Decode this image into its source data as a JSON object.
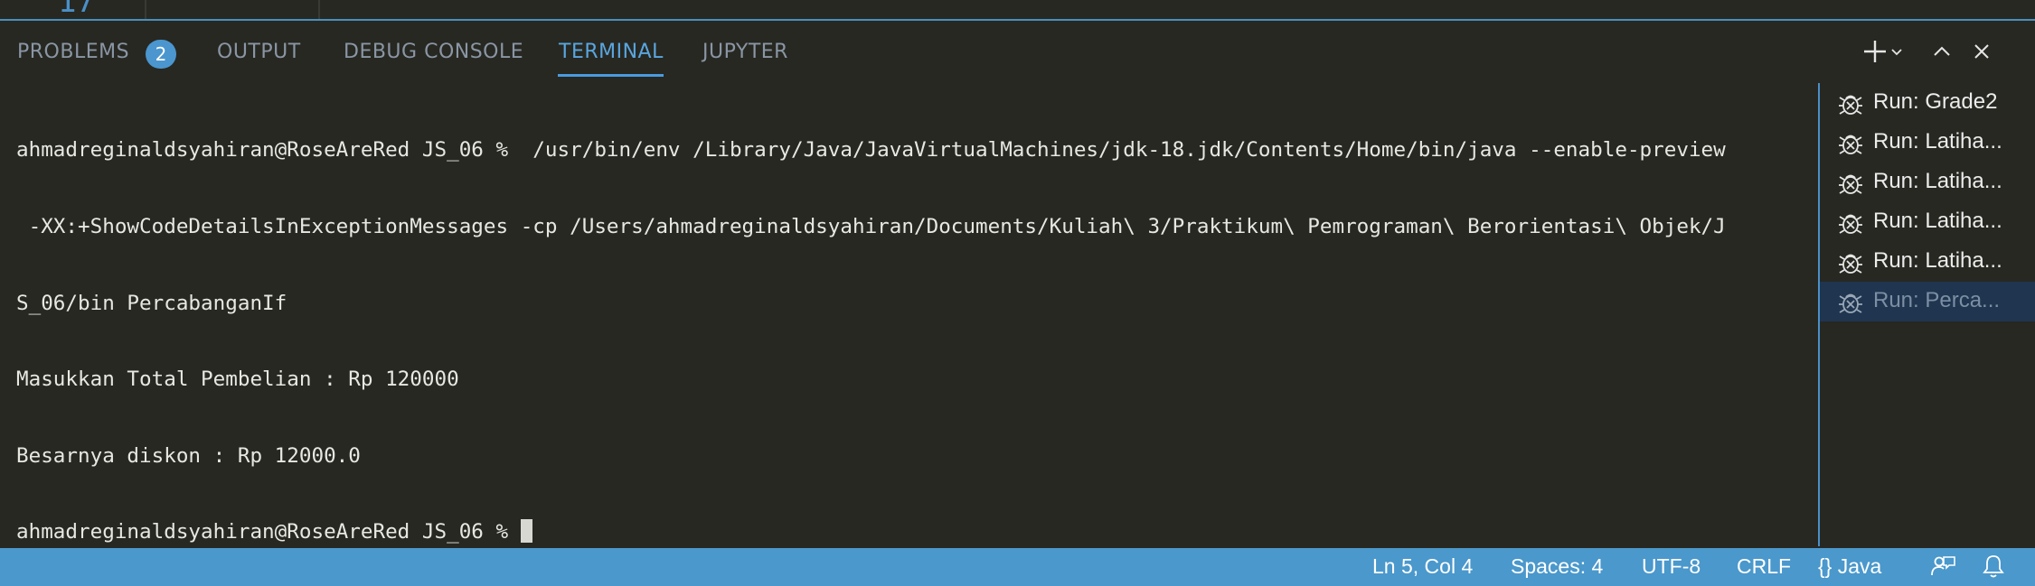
{
  "editor": {
    "visible_line_number": "17"
  },
  "panel": {
    "tabs": [
      {
        "label": "PROBLEMS",
        "badge": "2"
      },
      {
        "label": "OUTPUT"
      },
      {
        "label": "DEBUG CONSOLE"
      },
      {
        "label": "TERMINAL",
        "active": true
      },
      {
        "label": "JUPYTER"
      }
    ],
    "actions": [
      "plus-icon",
      "chevron-down-icon",
      "chevron-up-icon",
      "close-icon"
    ]
  },
  "terminal": {
    "lines": [
      "ahmadreginaldsyahiran@RoseAreRed JS_06 %  /usr/bin/env /Library/Java/JavaVirtualMachines/jdk-18.jdk/Contents/Home/bin/java --enable-preview",
      " -XX:+ShowCodeDetailsInExceptionMessages -cp /Users/ahmadreginaldsyahiran/Documents/Kuliah\\ 3/Praktikum\\ Pemrograman\\ Berorientasi\\ Objek/J",
      "S_06/bin PercabanganIf",
      "Masukkan Total Pembelian : Rp 120000",
      "Besarnya diskon : Rp 12000.0",
      "ahmadreginaldsyahiran@RoseAreRed JS_06 % "
    ]
  },
  "terminal_list": [
    {
      "label": "Run: Grade2",
      "icon": "debug-icon"
    },
    {
      "label": "Run: Latiha...",
      "icon": "debug-icon"
    },
    {
      "label": "Run: Latiha...",
      "icon": "debug-icon"
    },
    {
      "label": "Run: Latiha...",
      "icon": "debug-icon"
    },
    {
      "label": "Run: Latiha...",
      "icon": "debug-icon"
    },
    {
      "label": "Run: Perca...",
      "icon": "debug-icon",
      "selected": true
    }
  ],
  "statusbar": {
    "position": "Ln 5, Col 4",
    "spaces": "Spaces: 4",
    "encoding": "UTF-8",
    "eol": "CRLF",
    "language_icon": "{}",
    "language": "Java",
    "icons": [
      "feedback-icon",
      "bell-icon"
    ]
  },
  "colors": {
    "background": "#272822",
    "accent": "#4a98cc",
    "tab_active": "#5aa6e0",
    "tab_inactive": "#8a96a4"
  }
}
